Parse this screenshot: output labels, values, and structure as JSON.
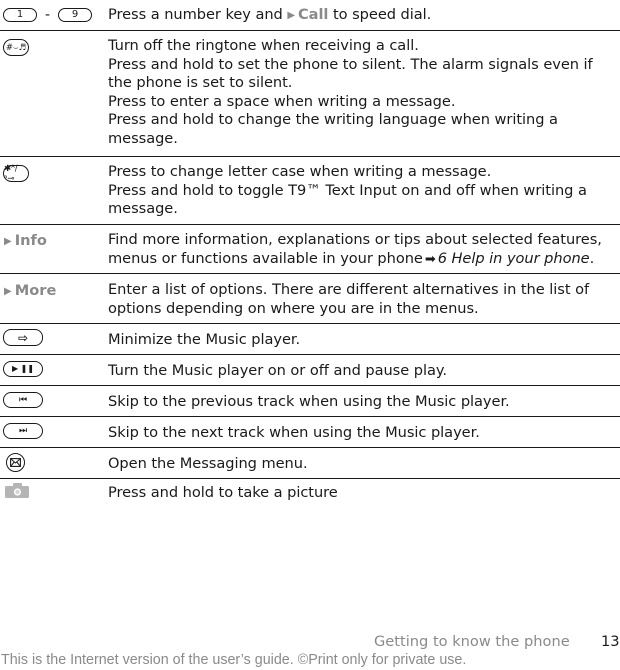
{
  "rows": [
    {
      "key": {
        "type": "key-range",
        "from": "1",
        "separator": "-",
        "to": "9"
      },
      "lines": [
        {
          "before": "Press a number key and",
          "softkey": "Call",
          "after": "to speed dial."
        }
      ]
    },
    {
      "key": {
        "type": "key",
        "label": "#⌣♬",
        "icon": "hash-key-icon"
      },
      "lines": [
        "Turn off the ringtone when receiving a call.",
        "Press and hold to set the phone to silent. The alarm signals even if",
        "the phone is set to silent.",
        "Press to enter a space when writing a message.",
        "Press and hold to change the writing language when writing a",
        "message."
      ]
    },
    {
      "key": {
        "type": "key",
        "label": "✱ᴬ/ᵃ⊸",
        "icon": "star-key-icon"
      },
      "lines": [
        "Press to change letter case when writing a message.",
        "Press and hold to toggle T9™  Text Input on and off when writing a",
        "message."
      ]
    },
    {
      "key": {
        "type": "softkey",
        "label": "Info"
      },
      "lines": [
        "Find more information, explanations or tips about selected features,",
        {
          "before": "menus or functions available in your phone",
          "ref": "6 Help in your phone",
          "after": "."
        }
      ]
    },
    {
      "key": {
        "type": "softkey",
        "label": "More"
      },
      "lines": [
        "Enter a list of options. There are different alternatives in the list of",
        "options depending on where you are in the menus."
      ]
    },
    {
      "key": {
        "type": "key",
        "label": "⇨",
        "icon": "minimize-key-icon"
      },
      "lines": [
        "Minimize the Music player."
      ]
    },
    {
      "key": {
        "type": "key",
        "label": "▶ ❚❚",
        "icon": "play-pause-key-icon"
      },
      "lines": [
        "Turn the Music player on or off and pause play."
      ]
    },
    {
      "key": {
        "type": "key",
        "label": "⏮",
        "icon": "previous-track-key-icon"
      },
      "lines": [
        "Skip to the previous track when using the Music player."
      ]
    },
    {
      "key": {
        "type": "key",
        "label": "⏭",
        "icon": "next-track-key-icon"
      },
      "lines": [
        "Skip to the next track when using the Music player."
      ]
    },
    {
      "key": {
        "type": "envelope",
        "icon": "messaging-key-icon"
      },
      "lines": [
        "Open the Messaging menu."
      ]
    },
    {
      "key": {
        "type": "camera",
        "icon": "camera-key-icon"
      },
      "lines": [
        "Press and hold to take a picture"
      ]
    }
  ],
  "footer": {
    "section": "Getting to know the phone",
    "page": "13",
    "notice": "This is the Internet version of the user’s guide. ©Print only for private use."
  },
  "colors": {
    "softkey": "#8a8a8a",
    "text": "#1a1a1a",
    "footer": "#8a8a8a"
  }
}
